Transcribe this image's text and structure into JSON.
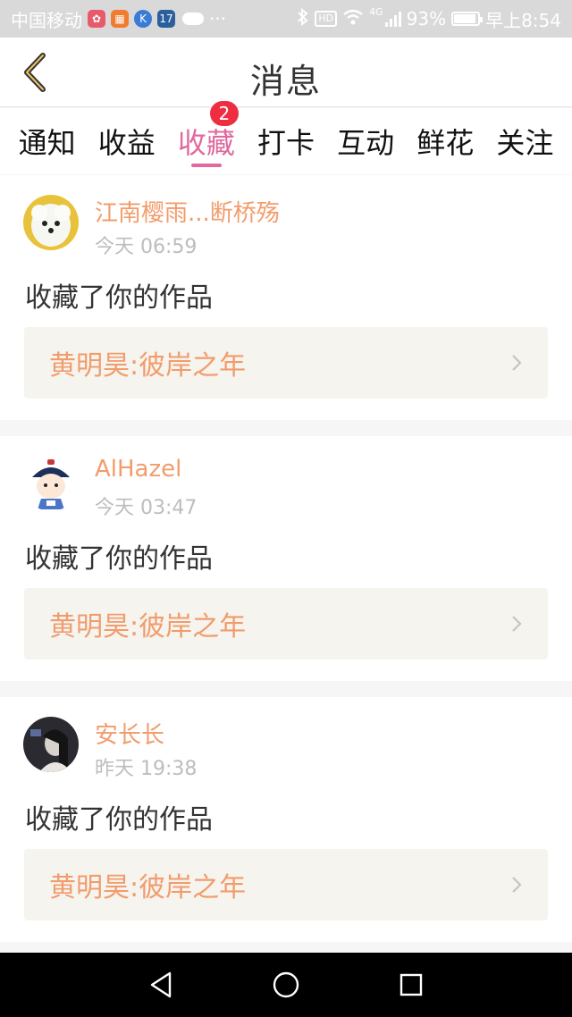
{
  "status_bar": {
    "carrier": "中国移动",
    "dots": "···",
    "hd": "HD",
    "network": "4G",
    "battery": "93%",
    "battery_level": 0.93,
    "time": "早上8:54",
    "app_icons": [
      "app-icon-1",
      "app-icon-2",
      "app-icon-3",
      "app-icon-4"
    ]
  },
  "header": {
    "title": "消息",
    "back_icon": "back-chevron-icon"
  },
  "tabs": [
    {
      "label": "通知"
    },
    {
      "label": "收益"
    },
    {
      "label": "收藏",
      "badge": "2",
      "active": true
    },
    {
      "label": "打卡"
    },
    {
      "label": "互动"
    },
    {
      "label": "鲜花"
    },
    {
      "label": "关注"
    }
  ],
  "messages": [
    {
      "user": "江南樱雨...断桥殇",
      "time": "今天 06:59",
      "action": "收藏了你的作品",
      "work": "黄明昊:彼岸之年",
      "avatar": "white-dog-avatar"
    },
    {
      "user": "AlHazel",
      "time": "今天 03:47",
      "action": "收藏了你的作品",
      "work": "黄明昊:彼岸之年",
      "avatar": "cartoon-avatar"
    },
    {
      "user": "安长长",
      "time": "昨天 19:38",
      "action": "收藏了你的作品",
      "work": "黄明昊:彼岸之年",
      "avatar": "dark-photo-avatar"
    }
  ],
  "colors": {
    "accent_pink": "#e0699e",
    "username_orange": "#f29c6c",
    "badge_red": "#ee2e40"
  },
  "navbar": {
    "back": "nav-back-icon",
    "home": "nav-home-icon",
    "recents": "nav-recents-icon"
  }
}
